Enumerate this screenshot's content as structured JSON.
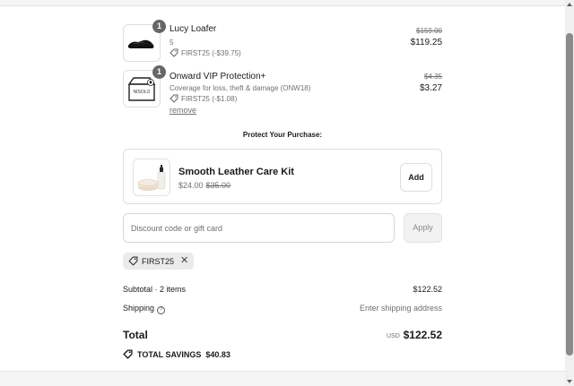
{
  "line_items": [
    {
      "title": "Lucy Loafer",
      "variant": "5",
      "quantity": "1",
      "discount": "FIRST25 (-$39.75)",
      "original_price": "$159.00",
      "price": "$119.25",
      "icon": "loafer-shoe-icon"
    },
    {
      "title": "Onward VIP Protection+",
      "variant": "Coverage for loss, theft & damage (ONW18)",
      "quantity": "1",
      "discount": "FIRST25 (-$1.08)",
      "original_price": "$4.35",
      "price": "$3.27",
      "remove_label": "remove",
      "icon": "protection-box-icon",
      "box_label": "NISOLO"
    }
  ],
  "protect": {
    "heading": "Protect Your Purchase:",
    "product": {
      "title": "Smooth Leather Care Kit",
      "price": "$24.00",
      "original_price": "$35.00",
      "add_label": "Add",
      "icon": "leather-care-kit-icon"
    }
  },
  "discount": {
    "placeholder": "Discount code or gift card",
    "apply_label": "Apply",
    "applied_code": "FIRST25"
  },
  "summary": {
    "subtotal_label": "Subtotal · 2 items",
    "subtotal_value": "$122.52",
    "shipping_label": "Shipping",
    "shipping_value": "Enter shipping address",
    "total_label": "Total",
    "currency": "USD",
    "total_value": "$122.52",
    "savings_label": "TOTAL SAVINGS",
    "savings_value": "$40.83"
  },
  "colors": {
    "text": "#1a1a1a",
    "muted": "#707070",
    "border": "#dedede",
    "badge": "#666666"
  }
}
